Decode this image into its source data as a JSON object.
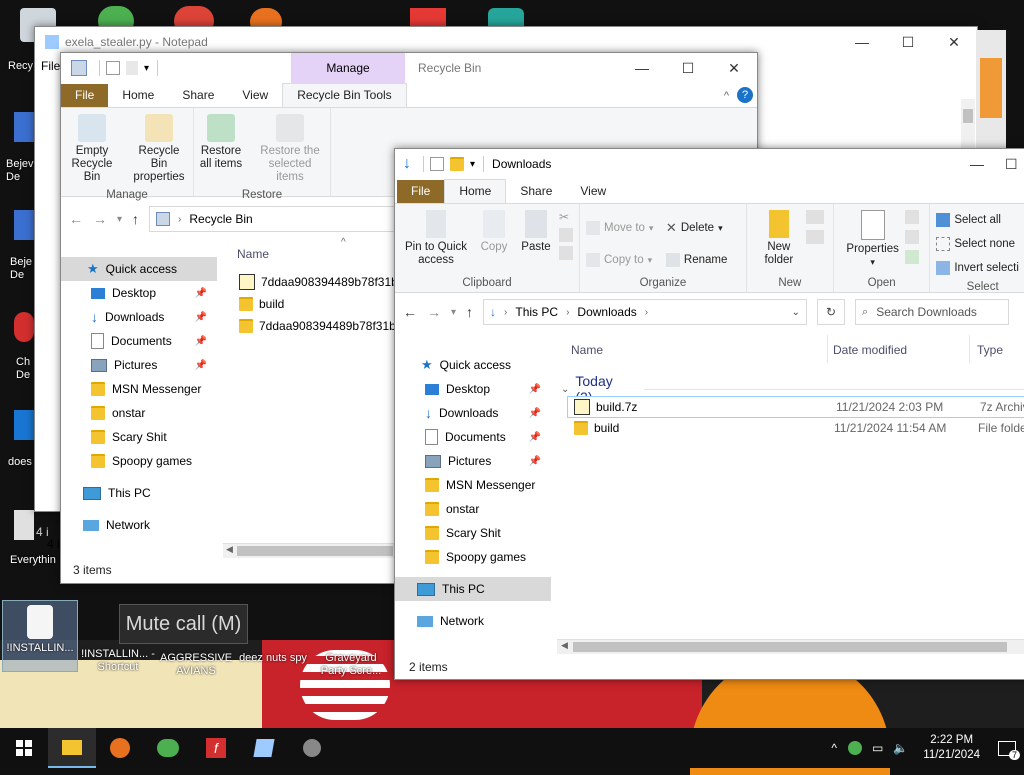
{
  "desktop": {
    "left_labels": [
      "Recy",
      "Bejev De",
      "Beje De",
      "Ch De",
      "does",
      "Everythin"
    ],
    "bottom_icons": [
      {
        "label": "!INSTALLIN..."
      },
      {
        "label": "!INSTALLIN... - Shortcut"
      },
      {
        "label": "AGGRESSIVE AVIANS"
      },
      {
        "label": "deez nuts spy"
      },
      {
        "label": "Graveyard Party Scre..."
      }
    ],
    "mute_tooltip": "Mute call (M)"
  },
  "notepad": {
    "title": "exela_stealer.py - Notepad",
    "menu_first": "File",
    "status_fragment": "4 i"
  },
  "recycle_bin": {
    "title": "Recycle Bin",
    "manage_tab": "Manage",
    "tabs": [
      "File",
      "Home",
      "Share",
      "View",
      "Recycle Bin Tools"
    ],
    "ribbon": {
      "manage_group": "Manage",
      "restore_group": "Restore",
      "empty_label": "Empty Recycle Bin",
      "properties_label": "Recycle Bin properties",
      "restore_all_label": "Restore all items",
      "restore_selected_label": "Restore the selected items"
    },
    "address": "Recycle Bin",
    "column_name": "Name",
    "nav": [
      {
        "label": "Quick access"
      },
      {
        "label": "Desktop"
      },
      {
        "label": "Downloads"
      },
      {
        "label": "Documents"
      },
      {
        "label": "Pictures"
      },
      {
        "label": "MSN Messenger"
      },
      {
        "label": "onstar"
      },
      {
        "label": "Scary Shit"
      },
      {
        "label": "Spoopy games"
      },
      {
        "label": "This PC"
      },
      {
        "label": "Network"
      }
    ],
    "files": [
      "7ddaa908394489b78f31be!",
      "build",
      "7ddaa908394489b78f31be!"
    ],
    "status": "3 items"
  },
  "downloads": {
    "title": "Downloads",
    "tabs": [
      "File",
      "Home",
      "Share",
      "View"
    ],
    "ribbon": {
      "pin_label": "Pin to Quick access",
      "copy_label": "Copy",
      "paste_label": "Paste",
      "clipboard_group": "Clipboard",
      "move_to": "Move to",
      "copy_to": "Copy to",
      "delete": "Delete",
      "rename": "Rename",
      "organize_group": "Organize",
      "new_folder": "New folder",
      "new_group": "New",
      "properties": "Properties",
      "open_group": "Open",
      "select_all": "Select all",
      "select_none": "Select none",
      "invert_selection": "Invert selecti",
      "select_group": "Select"
    },
    "breadcrumb": [
      "This PC",
      "Downloads"
    ],
    "search_placeholder": "Search Downloads",
    "columns": {
      "name": "Name",
      "date": "Date modified",
      "type": "Type"
    },
    "group_header": "Today (2)",
    "files": [
      {
        "name": "build.7z",
        "date": "11/21/2024 2:03 PM",
        "type": "7z Archiv"
      },
      {
        "name": "build",
        "date": "11/21/2024 11:54 AM",
        "type": "File folde"
      }
    ],
    "nav": [
      {
        "label": "Quick access"
      },
      {
        "label": "Desktop"
      },
      {
        "label": "Downloads"
      },
      {
        "label": "Documents"
      },
      {
        "label": "Pictures"
      },
      {
        "label": "MSN Messenger"
      },
      {
        "label": "onstar"
      },
      {
        "label": "Scary Shit"
      },
      {
        "label": "Spoopy games"
      },
      {
        "label": "This PC"
      },
      {
        "label": "Network"
      }
    ],
    "status": "2 items"
  },
  "taskbar": {
    "time": "2:22 PM",
    "date": "11/21/2024",
    "notification_count": "7",
    "icons": [
      "windows-start-icon",
      "file-explorer-icon",
      "firefox-icon",
      "msn-messenger-icon",
      "flash-icon",
      "notepad-icon",
      "settings-icon"
    ]
  }
}
